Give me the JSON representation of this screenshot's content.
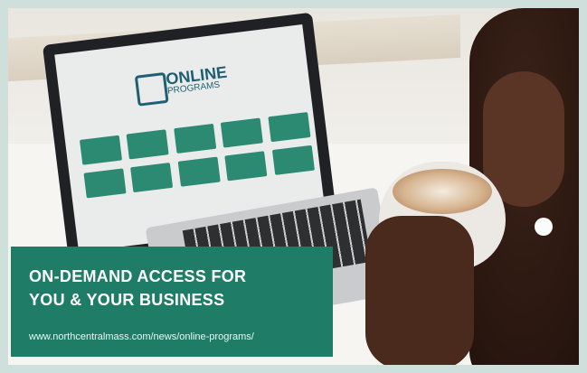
{
  "banner": {
    "headline_line1": "ON-DEMAND ACCESS FOR",
    "headline_line2": "YOU & YOUR BUSINESS",
    "url": "www.northcentralmass.com/news/online-programs/"
  },
  "screen": {
    "logo_word": "ONLINE",
    "logo_subword": "PROGRAMS"
  },
  "colors": {
    "banner_bg": "#1f7d67",
    "banner_text": "#ffffff",
    "frame_bg": "#cfe0dc"
  }
}
